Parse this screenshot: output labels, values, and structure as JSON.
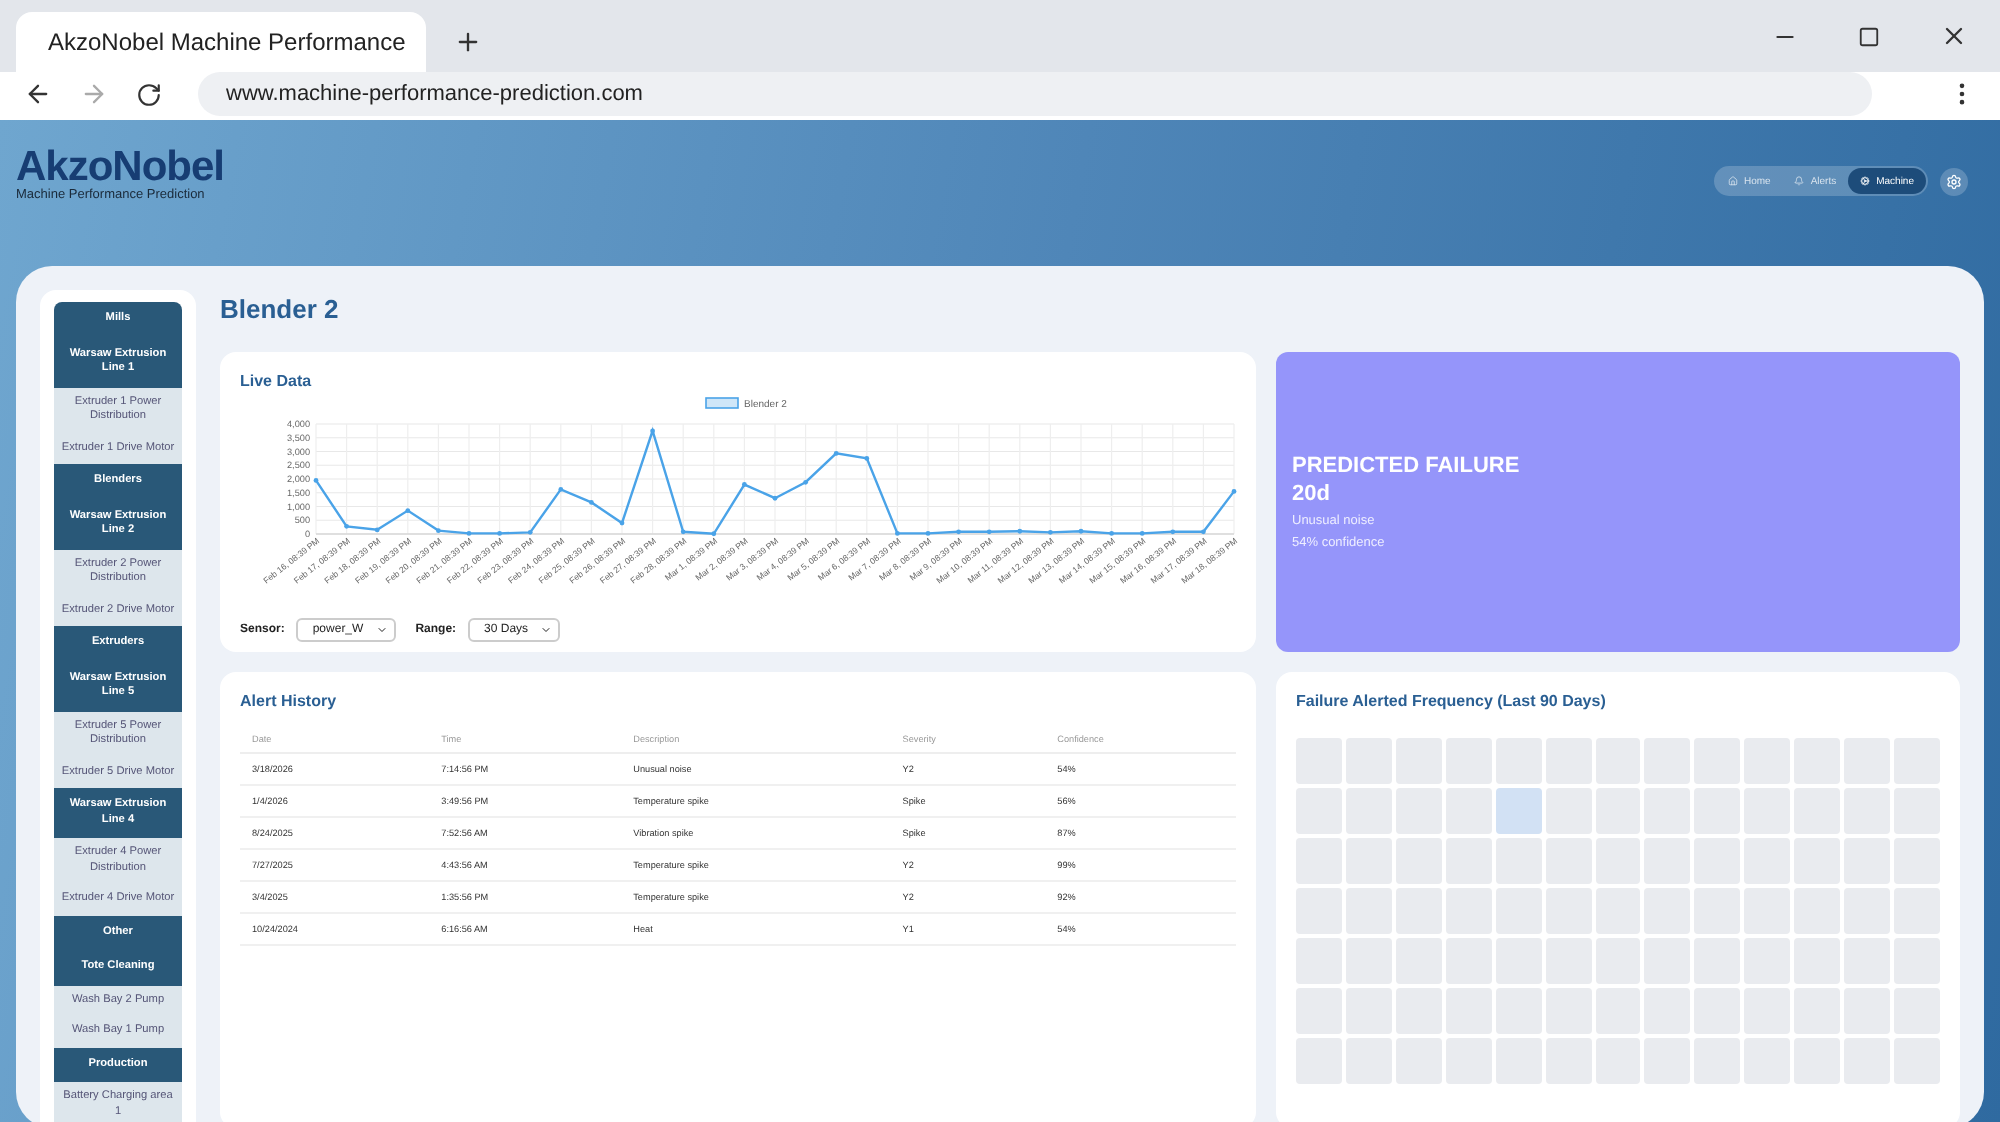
{
  "browser": {
    "tab_title": "AkzoNobel Machine Performance",
    "url": "www.machine-performance-prediction.com"
  },
  "header": {
    "logo": "AkzoNobel",
    "subtitle": "Machine Performance Prediction",
    "nav": [
      {
        "label": "Home",
        "selected": false
      },
      {
        "label": "Alerts",
        "selected": false
      },
      {
        "label": "Machine",
        "selected": true
      }
    ]
  },
  "sidebar": [
    {
      "kind": "category",
      "label": "Mills"
    },
    {
      "kind": "line",
      "label": "Warsaw Extrusion Line 1"
    },
    {
      "kind": "item",
      "label": "Extruder 1 Power Distribution"
    },
    {
      "kind": "item",
      "label": "Extruder 1 Drive Motor"
    },
    {
      "kind": "category",
      "label": "Blenders"
    },
    {
      "kind": "line",
      "label": "Warsaw Extrusion Line 2"
    },
    {
      "kind": "item",
      "label": "Extruder 2 Power Distribution"
    },
    {
      "kind": "item",
      "label": "Extruder 2 Drive Motor"
    },
    {
      "kind": "category",
      "label": "Extruders"
    },
    {
      "kind": "line",
      "label": "Warsaw Extrusion Line 5"
    },
    {
      "kind": "item",
      "label": "Extruder 5 Power Distribution"
    },
    {
      "kind": "item",
      "label": "Extruder 5 Drive Motor"
    },
    {
      "kind": "line",
      "label": "Warsaw Extrusion Line 4"
    },
    {
      "kind": "item",
      "label": "Extruder 4 Power Distribution"
    },
    {
      "kind": "item",
      "label": "Extruder 4 Drive Motor"
    },
    {
      "kind": "category",
      "label": "Other"
    },
    {
      "kind": "line",
      "label": "Tote Cleaning"
    },
    {
      "kind": "item",
      "label": "Wash Bay 2 Pump"
    },
    {
      "kind": "item",
      "label": "Wash Bay 1 Pump"
    },
    {
      "kind": "category",
      "label": "Production"
    },
    {
      "kind": "item",
      "label": "Battery Charging area 1"
    }
  ],
  "page_title": "Blender 2",
  "live_data": {
    "title": "Live Data",
    "chart_data": {
      "type": "line",
      "grid": true,
      "categories": [
        "Feb 16, 08:39 PM",
        "Feb 17, 08:39 PM",
        "Feb 18, 08:39 PM",
        "Feb 19, 08:39 PM",
        "Feb 20, 08:39 PM",
        "Feb 21, 08:39 PM",
        "Feb 22, 08:39 PM",
        "Feb 23, 08:39 PM",
        "Feb 24, 08:39 PM",
        "Feb 25, 08:39 PM",
        "Feb 26, 08:39 PM",
        "Feb 27, 08:39 PM",
        "Feb 28, 08:39 PM",
        "Mar 1, 08:39 PM",
        "Mar 2, 08:39 PM",
        "Mar 3, 08:39 PM",
        "Mar 4, 08:39 PM",
        "Mar 5, 08:39 PM",
        "Mar 6, 08:39 PM",
        "Mar 7, 08:39 PM",
        "Mar 8, 08:39 PM",
        "Mar 9, 08:39 PM",
        "Mar 10, 08:39 PM",
        "Mar 11, 08:39 PM",
        "Mar 12, 08:39 PM",
        "Mar 13, 08:39 PM",
        "Mar 14, 08:39 PM",
        "Mar 15, 08:39 PM",
        "Mar 16, 08:39 PM",
        "Mar 17, 08:39 PM",
        "Mar 18, 08:39 PM"
      ],
      "series": [
        {
          "name": "Blender 2",
          "color": "#4aa3e8",
          "values": [
            1950,
            280,
            150,
            850,
            120,
            20,
            20,
            60,
            1620,
            1150,
            400,
            3750,
            80,
            10,
            1800,
            1300,
            1880,
            2930,
            2750,
            20,
            20,
            80,
            80,
            100,
            60,
            100,
            20,
            20,
            80,
            80,
            1550
          ]
        }
      ],
      "ylim": [
        0,
        4000
      ],
      "yticks": [
        {
          "value": 0,
          "label": "0"
        },
        {
          "value": 500,
          "label": "500"
        },
        {
          "value": 1000,
          "label": "1,000"
        },
        {
          "value": 1500,
          "label": "1,500"
        },
        {
          "value": 2000,
          "label": "2,000"
        },
        {
          "value": 2500,
          "label": "2,500"
        },
        {
          "value": 3000,
          "label": "3,000"
        },
        {
          "value": 3500,
          "label": "3,500"
        },
        {
          "value": 4000,
          "label": "4,000"
        }
      ]
    },
    "controls": [
      {
        "label": "Sensor:",
        "value": "power_W"
      },
      {
        "label": "Range:",
        "value": "30 Days"
      }
    ]
  },
  "prediction": {
    "title": "PREDICTED FAILURE",
    "days": "20d",
    "description": "Unusual noise",
    "confidence": "54% confidence"
  },
  "alert_history": {
    "title": "Alert History",
    "columns": [
      "Date",
      "Time",
      "Description",
      "Severity",
      "Confidence"
    ],
    "rows": [
      [
        "3/18/2026",
        "7:14:56 PM",
        "Unusual noise",
        "Y2",
        "54%"
      ],
      [
        "1/4/2026",
        "3:49:56 PM",
        "Temperature spike",
        "Spike",
        "56%"
      ],
      [
        "8/24/2025",
        "7:52:56 AM",
        "Vibration spike",
        "Spike",
        "87%"
      ],
      [
        "7/27/2025",
        "4:43:56 AM",
        "Temperature spike",
        "Y2",
        "99%"
      ],
      [
        "3/4/2025",
        "1:35:56 PM",
        "Temperature spike",
        "Y2",
        "92%"
      ],
      [
        "10/24/2024",
        "6:16:56 AM",
        "Heat",
        "Y1",
        "54%"
      ]
    ]
  },
  "frequency": {
    "title": "Failure Alerted Frequency (Last 90 Days)",
    "rows": [
      {
        "cells": [
          {
            "color": "#e9ebef"
          },
          {
            "color": "#e9ebef"
          },
          {
            "color": "#e9ebef"
          },
          {
            "color": "#e9ebef"
          },
          {
            "color": "#e9ebef"
          },
          {
            "color": "#e9ebef"
          },
          {
            "color": "#e9ebef"
          },
          {
            "color": "#e9ebef"
          },
          {
            "color": "#e9ebef"
          },
          {
            "color": "#e9ebef"
          },
          {
            "color": "#e9ebef"
          },
          {
            "color": "#e9ebef"
          },
          {
            "color": "#e9ebef"
          }
        ]
      },
      {
        "cells": [
          {
            "color": "#e9ebef"
          },
          {
            "color": "#e9ebef"
          },
          {
            "color": "#e9ebef"
          },
          {
            "color": "#e9ebef"
          },
          {
            "color": "#d2e1f4"
          },
          {
            "color": "#e9ebef"
          },
          {
            "color": "#e9ebef"
          },
          {
            "color": "#e9ebef"
          },
          {
            "color": "#e9ebef"
          },
          {
            "color": "#e9ebef"
          },
          {
            "color": "#e9ebef"
          },
          {
            "color": "#e9ebef"
          },
          {
            "color": "#e9ebef"
          }
        ]
      },
      {
        "cells": [
          {
            "color": "#e9ebef"
          },
          {
            "color": "#e9ebef"
          },
          {
            "color": "#e9ebef"
          },
          {
            "color": "#e9ebef"
          },
          {
            "color": "#e9ebef"
          },
          {
            "color": "#e9ebef"
          },
          {
            "color": "#e9ebef"
          },
          {
            "color": "#e9ebef"
          },
          {
            "color": "#e9ebef"
          },
          {
            "color": "#e9ebef"
          },
          {
            "color": "#e9ebef"
          },
          {
            "color": "#e9ebef"
          },
          {
            "color": "#e9ebef"
          }
        ]
      },
      {
        "cells": [
          {
            "color": "#e9ebef"
          },
          {
            "color": "#e9ebef"
          },
          {
            "color": "#e9ebef"
          },
          {
            "color": "#e9ebef"
          },
          {
            "color": "#e9ebef"
          },
          {
            "color": "#e9ebef"
          },
          {
            "color": "#e9ebef"
          },
          {
            "color": "#e9ebef"
          },
          {
            "color": "#e9ebef"
          },
          {
            "color": "#e9ebef"
          },
          {
            "color": "#e9ebef"
          },
          {
            "color": "#e9ebef"
          },
          {
            "color": "#e9ebef"
          }
        ]
      },
      {
        "cells": [
          {
            "color": "#e9ebef"
          },
          {
            "color": "#e9ebef"
          },
          {
            "color": "#e9ebef"
          },
          {
            "color": "#e9ebef"
          },
          {
            "color": "#e9ebef"
          },
          {
            "color": "#e9ebef"
          },
          {
            "color": "#e9ebef"
          },
          {
            "color": "#e9ebef"
          },
          {
            "color": "#e9ebef"
          },
          {
            "color": "#e9ebef"
          },
          {
            "color": "#e9ebef"
          },
          {
            "color": "#e9ebef"
          },
          {
            "color": "#e9ebef"
          }
        ]
      },
      {
        "cells": [
          {
            "color": "#e9ebef"
          },
          {
            "color": "#e9ebef"
          },
          {
            "color": "#e9ebef"
          },
          {
            "color": "#e9ebef"
          },
          {
            "color": "#e9ebef"
          },
          {
            "color": "#e9ebef"
          },
          {
            "color": "#e9ebef"
          },
          {
            "color": "#e9ebef"
          },
          {
            "color": "#e9ebef"
          },
          {
            "color": "#e9ebef"
          },
          {
            "color": "#e9ebef"
          },
          {
            "color": "#e9ebef"
          },
          {
            "color": "#e9ebef"
          }
        ]
      },
      {
        "cells": [
          {
            "color": "#e9ebef"
          },
          {
            "color": "#e9ebef"
          },
          {
            "color": "#e9ebef"
          },
          {
            "color": "#e9ebef"
          },
          {
            "color": "#e9ebef"
          },
          {
            "color": "#e9ebef"
          },
          {
            "color": "#e9ebef"
          },
          {
            "color": "#e9ebef"
          },
          {
            "color": "#e9ebef"
          },
          {
            "color": "#e9ebef"
          },
          {
            "color": "#e9ebef"
          },
          {
            "color": "#e9ebef"
          },
          {
            "color": "#e9ebef"
          }
        ]
      }
    ]
  }
}
